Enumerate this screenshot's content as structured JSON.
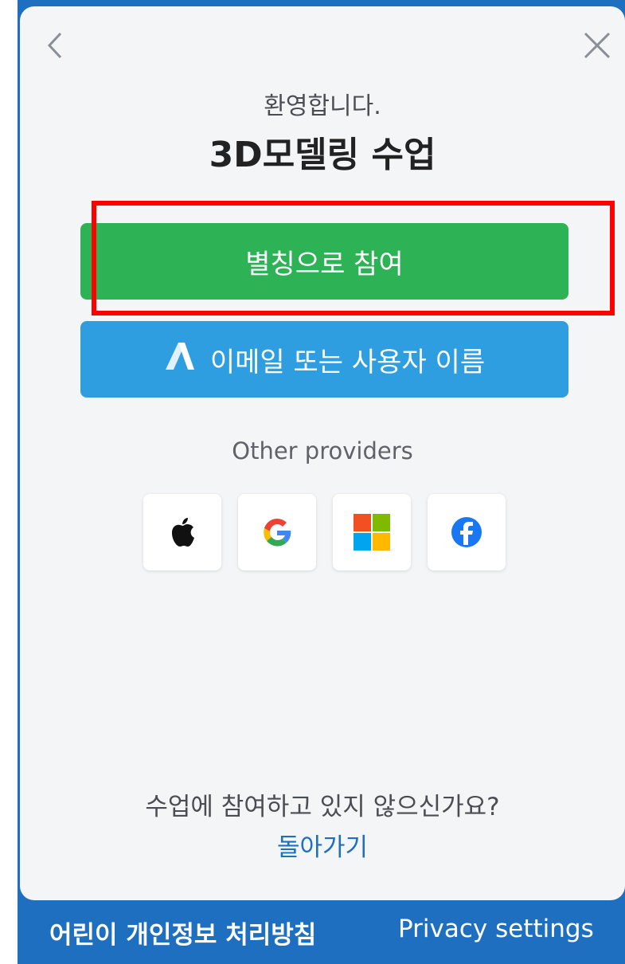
{
  "header": {
    "welcome": "환영합니다.",
    "title": "3D모델링 수업"
  },
  "buttons": {
    "nickname_join": "별칭으로 참여",
    "email_or_username": "이메일 또는 사용자 이름"
  },
  "providers": {
    "label": "Other providers",
    "items": [
      "apple-icon",
      "google-icon",
      "microsoft-icon",
      "facebook-icon"
    ]
  },
  "bottom": {
    "question": "수업에 참여하고 있지 않으신가요?",
    "go_back": "돌아가기"
  },
  "footer": {
    "privacy_policy": "어린이 개인정보 처리방침",
    "privacy_settings": "Privacy settings"
  },
  "colors": {
    "green": "#2db256",
    "blue": "#2f9ee0",
    "frame": "#1f6fc0",
    "highlight": "#ff0000"
  }
}
